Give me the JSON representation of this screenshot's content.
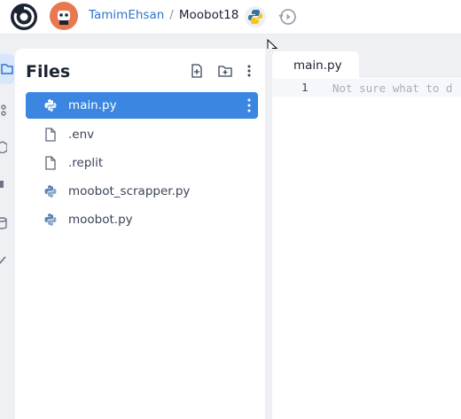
{
  "header": {
    "owner": "TamimEhsan",
    "separator": "/",
    "repl_name": "Moobot18"
  },
  "icons": {
    "logo": "replit-logo-icon",
    "avatar": "user-avatar",
    "language": "python-icon",
    "history": "history-icon"
  },
  "files_panel": {
    "title": "Files",
    "items": [
      {
        "label": "main.py",
        "icon": "python-icon",
        "active": true
      },
      {
        "label": ".env",
        "icon": "file-icon",
        "active": false
      },
      {
        "label": ".replit",
        "icon": "file-icon",
        "active": false
      },
      {
        "label": "moobot_scrapper.py",
        "icon": "python-icon",
        "active": false
      },
      {
        "label": "moobot.py",
        "icon": "python-icon",
        "active": false
      }
    ]
  },
  "editor": {
    "tab_label": "main.py",
    "line_number": "1",
    "placeholder": "Not sure what to d"
  },
  "colors": {
    "accent": "#3a86e0",
    "link": "#2f75c9",
    "background": "#eef0f3"
  }
}
